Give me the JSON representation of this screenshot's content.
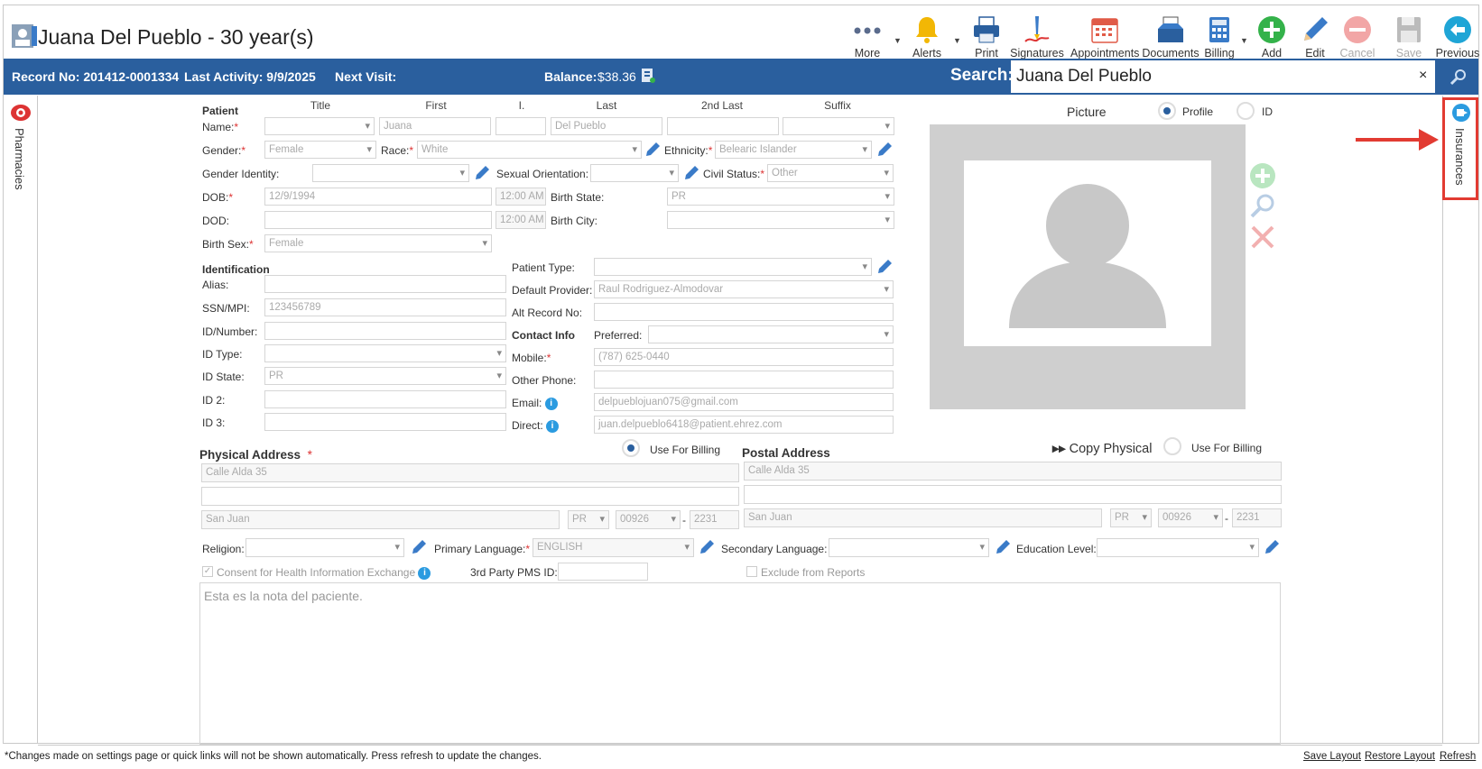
{
  "header": {
    "title": "Juana Del Pueblo - 30 year(s)",
    "toolbar": [
      {
        "id": "more",
        "label": "More"
      },
      {
        "id": "alerts",
        "label": "Alerts"
      },
      {
        "id": "print",
        "label": "Print"
      },
      {
        "id": "signatures",
        "label": "Signatures"
      },
      {
        "id": "appointments",
        "label": "Appointments"
      },
      {
        "id": "documents",
        "label": "Documents"
      },
      {
        "id": "billing",
        "label": "Billing"
      },
      {
        "id": "add",
        "label": "Add"
      },
      {
        "id": "edit",
        "label": "Edit"
      },
      {
        "id": "cancel",
        "label": "Cancel"
      },
      {
        "id": "save",
        "label": "Save"
      },
      {
        "id": "previous",
        "label": "Previous"
      }
    ]
  },
  "infobar": {
    "record_no": "Record No: 201412-0001334",
    "last_activity": "Last Activity: 9/9/2025",
    "next_visit": "Next Visit:",
    "balance_label": "Balance:",
    "balance_value": "$38.36",
    "search_label": "Search:",
    "search_value": "Juana Del Pueblo",
    "search_clear": "×"
  },
  "side": {
    "left_tab": "Pharmacies",
    "right_tab": "Insurances"
  },
  "patient": {
    "section": "Patient",
    "cols": {
      "title": "Title",
      "first": "First",
      "initial": "I.",
      "last": "Last",
      "last2": "2nd Last",
      "suffix": "Suffix"
    },
    "name_label": "Name:",
    "first": "Juana",
    "last": "Del Pueblo",
    "gender_label": "Gender:",
    "gender": "Female",
    "race_label": "Race:",
    "race": "White",
    "ethnicity_label": "Ethnicity:",
    "ethnicity": "Belearic Islander",
    "gender_identity_label": "Gender Identity:",
    "sexual_orientation_label": "Sexual Orientation:",
    "civil_status_label": "Civil Status:",
    "civil_status": "Other",
    "dob_label": "DOB:",
    "dob": "12/9/1994",
    "dob_time": "12:00 AM",
    "birth_state_label": "Birth State:",
    "birth_state": "PR",
    "dod_label": "DOD:",
    "dod_time": "12:00 AM",
    "birth_city_label": "Birth City:",
    "birth_sex_label": "Birth Sex:",
    "birth_sex": "Female"
  },
  "identification": {
    "section": "Identification",
    "alias_label": "Alias:",
    "ssn_label": "SSN/MPI:",
    "ssn": "123456789",
    "id_number_label": "ID/Number:",
    "id_type_label": "ID Type:",
    "id_state_label": "ID State:",
    "id_state": "PR",
    "id2_label": "ID 2:",
    "id3_label": "ID 3:",
    "patient_type_label": "Patient Type:",
    "default_provider_label": "Default Provider:",
    "default_provider": "Raul Rodriguez-Almodovar",
    "alt_record_label": "Alt Record No:"
  },
  "contact": {
    "section": "Contact Info",
    "preferred_label": "Preferred:",
    "mobile_label": "Mobile:",
    "mobile": "(787) 625-0440",
    "other_phone_label": "Other Phone:",
    "email_label": "Email:",
    "email": "delpueblojuan075@gmail.com",
    "direct_label": "Direct:",
    "direct": "juan.delpueblo6418@patient.ehrez.com"
  },
  "picture": {
    "label": "Picture",
    "profile": "Profile",
    "id": "ID"
  },
  "physical": {
    "label": "Physical Address",
    "use_billing": "Use For Billing",
    "line1": "Calle Alda 35",
    "city": "San Juan",
    "state": "PR",
    "zip": "00926",
    "zip4": "2231"
  },
  "postal": {
    "label": "Postal Address",
    "copy": "Copy Physical",
    "use_billing": "Use For Billing",
    "line1": "Calle Alda 35",
    "city": "San Juan",
    "state": "PR",
    "zip": "00926",
    "zip4": "2231"
  },
  "misc": {
    "religion_label": "Religion:",
    "primary_lang_label": "Primary Language:",
    "primary_lang": "ENGLISH",
    "secondary_lang_label": "Secondary Language:",
    "education_label": "Education Level:",
    "consent": "Consent for Health Information Exchange",
    "pms_label": "3rd Party PMS ID:",
    "exclude": "Exclude from Reports",
    "notes": "Esta es la nota del paciente.",
    "dash": "-"
  },
  "footer": {
    "note": "*Changes made on settings page or quick links will not be shown automatically. Press refresh to update the changes.",
    "save_layout": "Save Layout",
    "restore_layout": "Restore Layout",
    "refresh": "Refresh"
  },
  "colors": {
    "accent": "#2a5f9e",
    "highlight": "#e23b32",
    "add": "#34b24a",
    "cancel": "#f2a6a6",
    "info": "#2b9be0"
  }
}
